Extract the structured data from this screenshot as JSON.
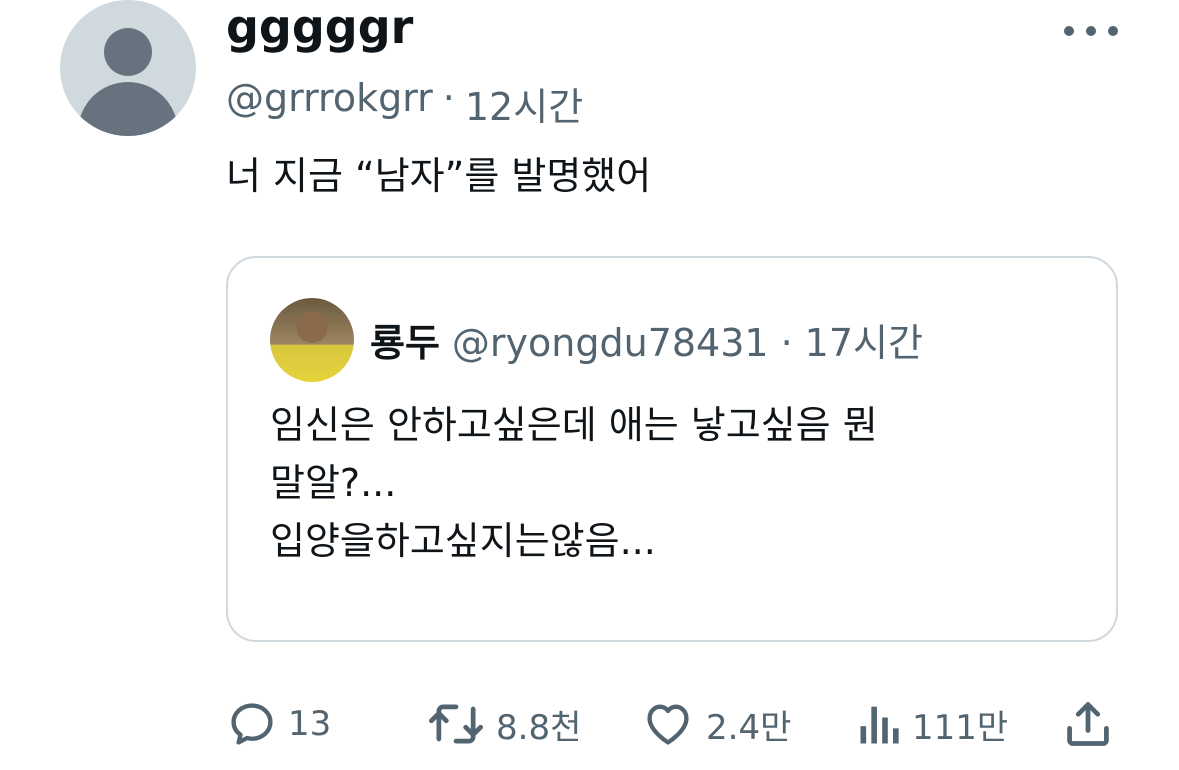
{
  "tweet": {
    "display_name": "gggggr",
    "handle": "@grrrokgrr",
    "separator": "·",
    "time": "12시간",
    "text": "너 지금 “남자”를 발명했어"
  },
  "quoted": {
    "display_name": "룡두",
    "handle": "@ryongdu78431",
    "separator": "·",
    "time": "17시간",
    "text": "임신은 안하고싶은데 애는 낳고싶음 뭔\n말알?...\n입양을하고싶지는않음..."
  },
  "actions": {
    "replies": "13",
    "retweets": "8.8천",
    "likes": "2.4만",
    "views": "111만"
  },
  "icons": {
    "more": "more-dots-icon",
    "reply": "reply-icon",
    "retweet": "retweet-icon",
    "like": "heart-icon",
    "views": "views-icon",
    "share": "share-icon"
  },
  "colors": {
    "text": "#0f1419",
    "secondary": "#536471",
    "border": "#cfd9de"
  }
}
